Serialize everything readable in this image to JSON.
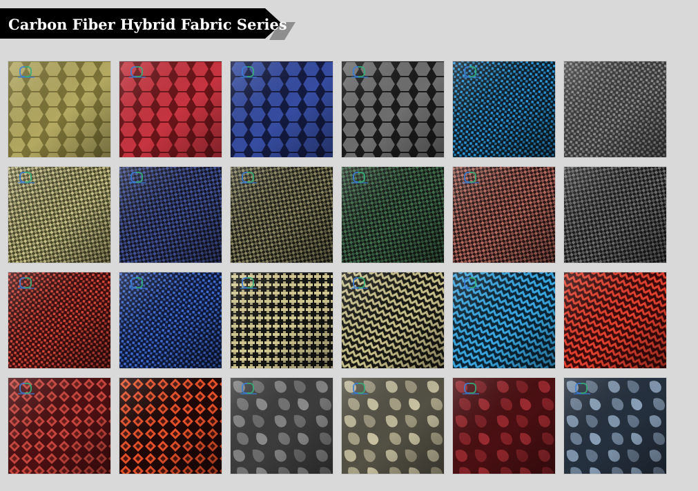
{
  "header": {
    "title": "Carbon Fiber Hybrid Fabric Series"
  },
  "tiles": [
    {
      "name": "aramid-hexagon-fabric",
      "base": "#7a7236",
      "fg": "#bdb36a",
      "pattern": "hex",
      "logo": true
    },
    {
      "name": "red-hexagon-fabric",
      "base": "#6a1418",
      "fg": "#d63a46",
      "pattern": "hex",
      "logo": true
    },
    {
      "name": "blue-hexagon-fabric",
      "base": "#131a40",
      "fg": "#3c55b0",
      "pattern": "hex",
      "logo": true
    },
    {
      "name": "black-hexagon-fabric",
      "base": "#1a1a1a",
      "fg": "#7d7d7d",
      "pattern": "hex",
      "logo": true
    },
    {
      "name": "blue-plain-fabric",
      "base": "#0d1e2a",
      "fg": "#2a95d6",
      "pattern": "plain",
      "logo": true
    },
    {
      "name": "grey-roll-fabric",
      "base": "#3a3a3a",
      "fg": "#8c8c8c",
      "pattern": "plain",
      "logo": false
    },
    {
      "name": "aramid-twill-fabric",
      "base": "#4a4a2a",
      "fg": "#c9c08a",
      "pattern": "twill",
      "logo": true
    },
    {
      "name": "blue-twill-fabric",
      "base": "#141625",
      "fg": "#42539a",
      "pattern": "twill",
      "logo": true
    },
    {
      "name": "gold-twill-fabric",
      "base": "#1e1e18",
      "fg": "#8b8760",
      "pattern": "twill",
      "logo": true
    },
    {
      "name": "green-twill-fabric",
      "base": "#161a16",
      "fg": "#3e6e4a",
      "pattern": "twill",
      "logo": true
    },
    {
      "name": "red-twill-fabric",
      "base": "#2a1616",
      "fg": "#b56a5e",
      "pattern": "twill",
      "logo": true
    },
    {
      "name": "black-twill-fabric",
      "base": "#1a1a1a",
      "fg": "#6e6e6e",
      "pattern": "twill",
      "logo": false
    },
    {
      "name": "red-jacquard-fabric",
      "base": "#3a0e0e",
      "fg": "#d4473a",
      "pattern": "plain",
      "logo": true
    },
    {
      "name": "blue-jacquard-fabric",
      "base": "#0e1838",
      "fg": "#3f6bd0",
      "pattern": "plain",
      "logo": true
    },
    {
      "name": "aramid-cross-fabric",
      "base": "#151512",
      "fg": "#d5ca92",
      "pattern": "cross",
      "logo": true
    },
    {
      "name": "aramid-zigzag-fabric",
      "base": "#181814",
      "fg": "#c8c08a",
      "pattern": "zigzag",
      "logo": true
    },
    {
      "name": "light-blue-weave-fabric",
      "base": "#0b2434",
      "fg": "#39a7e0",
      "pattern": "zigzag",
      "logo": true
    },
    {
      "name": "red-zigzag-fabric",
      "base": "#3a0a0a",
      "fg": "#e2402e",
      "pattern": "zigzag",
      "logo": false
    },
    {
      "name": "red-diamond-fabric",
      "base": "#4c1012",
      "fg": "#c8463e",
      "pattern": "diamond",
      "logo": true
    },
    {
      "name": "orange-diamond-fabric",
      "base": "#200808",
      "fg": "#e8512a",
      "pattern": "diamond",
      "logo": false
    },
    {
      "name": "grey-camo-fabric",
      "base": "#3c3c3c",
      "fg": "#8a8a8a",
      "pattern": "camo",
      "logo": true
    },
    {
      "name": "tan-camo-fabric",
      "base": "#535144",
      "fg": "#c9c2a2",
      "pattern": "camo",
      "logo": true
    },
    {
      "name": "red-camo-fabric",
      "base": "#4a0f12",
      "fg": "#9a2a30",
      "pattern": "camo",
      "logo": true
    },
    {
      "name": "blue-camo-fabric",
      "base": "#25303e",
      "fg": "#8aa0b8",
      "pattern": "camo",
      "logo": true
    }
  ]
}
